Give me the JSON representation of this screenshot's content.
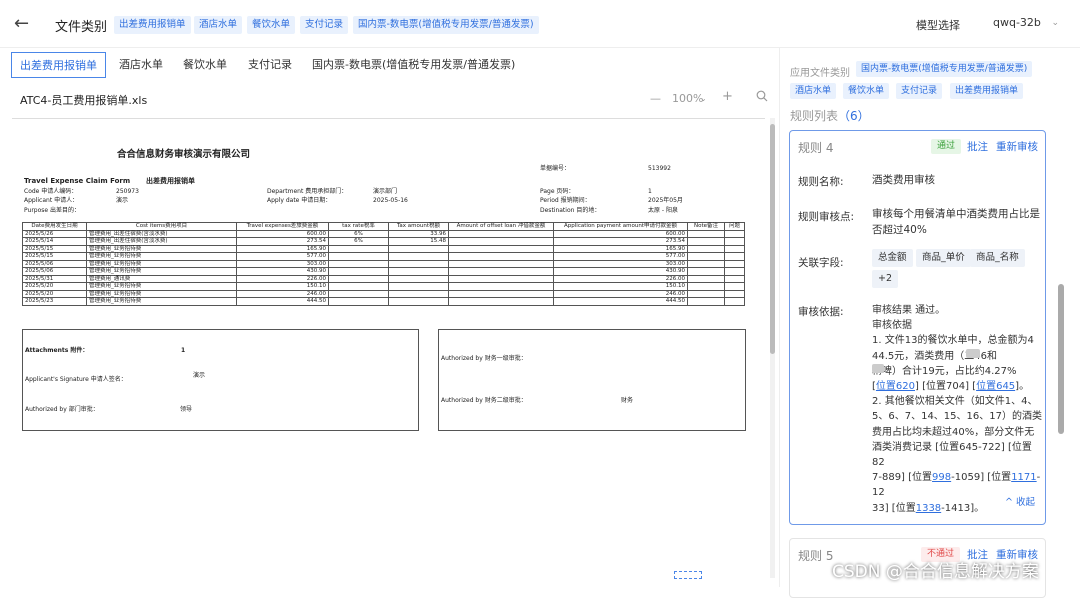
{
  "header": {
    "back_icon": "arrow-left-icon",
    "title": "文件类别",
    "tags": [
      "出差费用报销单",
      "酒店水单",
      "餐饮水单",
      "支付记录",
      "国内票-数电票(增值税专用发票/普通发票)"
    ],
    "model_label": "模型选择",
    "model_value": "qwq-32b"
  },
  "tabs": [
    "出差费用报销单",
    "酒店水单",
    "餐饮水单",
    "支付记录",
    "国内票-数电票(增值税专用发票/普通发票)"
  ],
  "file": {
    "name": "ATC4-员工费用报销单.xls",
    "zoom": "100%",
    "minus": "—",
    "plus": "+"
  },
  "document": {
    "company": "合合信息财务审核演示有限公司",
    "form_no_label": "单据编号：",
    "form_no": "513992",
    "form_title_en": "Travel Expense Claim Form",
    "form_title_cn": "出差费用报销单",
    "code_label": "Code 申请人编码：",
    "code": "250973",
    "applicant_label": "Applicant 申请人：",
    "applicant": "演示",
    "purpose_label": "Purpose 出差目的：",
    "dept_label": "Department 费用承担部门：",
    "dept": "演示部门",
    "apply_date_label": "Apply date 申请日期：",
    "apply_date": "2025-05-16",
    "page_label": "Page 页码：",
    "page": "1",
    "period_label": "Period 报销期间：",
    "period": "2025年05月",
    "destination_label": "Destination 目的地：",
    "destination": "太原 - 阳泉",
    "columns": [
      "Date费用发生日期",
      "Cost items费用项目",
      "Travel expenses差旅费金额",
      "tax rate税率",
      "Tax amount税额",
      "Amount of offset loan 冲借款金额",
      "Application payment amount申请付款金额",
      "Note备注",
      "问题"
    ],
    "rows": [
      [
        "2025/5/26",
        "管理费用_出差住宿费(含淡水费)",
        "600.00",
        "6%",
        "33.96",
        "",
        "600.00",
        "",
        ""
      ],
      [
        "2025/5/14",
        "管理费用_出差住宿费(含淡水费)",
        "273.54",
        "6%",
        "15.48",
        "",
        "273.54",
        "",
        ""
      ],
      [
        "2025/5/15",
        "管理费用_业务招待费",
        "165.90",
        "",
        "",
        "",
        "165.90",
        "",
        ""
      ],
      [
        "2025/5/15",
        "管理费用_业务招待费",
        "577.00",
        "",
        "",
        "",
        "577.00",
        "",
        ""
      ],
      [
        "2025/5/06",
        "管理费用_业务招待费",
        "303.00",
        "",
        "",
        "",
        "303.00",
        "",
        ""
      ],
      [
        "2025/5/06",
        "管理费用_业务招待费",
        "430.90",
        "",
        "",
        "",
        "430.90",
        "",
        ""
      ],
      [
        "2025/5/31",
        "管理费用_通讯费",
        "226.00",
        "",
        "",
        "",
        "226.00",
        "",
        ""
      ],
      [
        "2025/5/20",
        "管理费用_业务招待费",
        "150.10",
        "",
        "",
        "",
        "150.10",
        "",
        ""
      ],
      [
        "2025/5/20",
        "管理费用_业务招待费",
        "246.00",
        "",
        "",
        "",
        "246.00",
        "",
        ""
      ],
      [
        "2025/5/23",
        "管理费用_业务招待费",
        "444.50",
        "",
        "",
        "",
        "444.50",
        "",
        ""
      ]
    ],
    "attachments_label": "Attachments 附件：",
    "attachments": "1",
    "signature_label": "Applicant's Signature 申请人签名：",
    "signature": "演示",
    "dept_auth_label": "Authorized by 部门审批：",
    "dept_auth": "领导",
    "fin1_label": "Authorized by 财务一级审批：",
    "fin2_label": "Authorized by 财务二级审批：",
    "fin2": "财务"
  },
  "right_panel": {
    "apply_label": "应用文件类别",
    "apply_tags": [
      "国内票-数电票(增值税专用发票/普通发票)",
      "酒店水单",
      "餐饮水单",
      "支付记录",
      "出差费用报销单"
    ],
    "rules_title": "规则列表",
    "rules_count": "（6）",
    "rule4": {
      "title": "规则 4",
      "status": "通过",
      "annotate": "批注",
      "recheck": "重新审核",
      "name_label": "规则名称:",
      "name": "酒类费用审核",
      "point_label": "规则审核点:",
      "point": "审核每个用餐清单中酒类费用占比是否超过40%",
      "fields_label": "关联字段:",
      "fields": [
        "总金额",
        "商品_单价",
        "商品_名称",
        "+2"
      ],
      "basis_label": "审核依据:",
      "basis_lines": [
        "审核结果 通过。",
        "审核依据",
        "1. 文件13的餐饮水单中，总金额为4",
        "44.5元，酒类费用（",
        "二46和",
        "精啤）合计19元，占比约4.27%",
        "位置620",
        "[位置704]",
        "位置645",
        "2. 其他餐饮相关文件（如文件1、4、",
        "5、6、7、14、15、16、17）的酒类",
        "费用占比均未超过40%，部分文件无",
        "酒类消费记录 [位置645-722] [位置82",
        "7-889] [位置",
        "998",
        "-1059] [位置",
        "1171",
        "-12",
        "33] [位置",
        "1338",
        "-1413]。"
      ],
      "collapse": "收起"
    },
    "rule5": {
      "title": "规则 5",
      "status": "不通过",
      "annotate": "批注",
      "recheck": "重新审核"
    }
  },
  "watermark": "CSDN @合合信息解决方案"
}
